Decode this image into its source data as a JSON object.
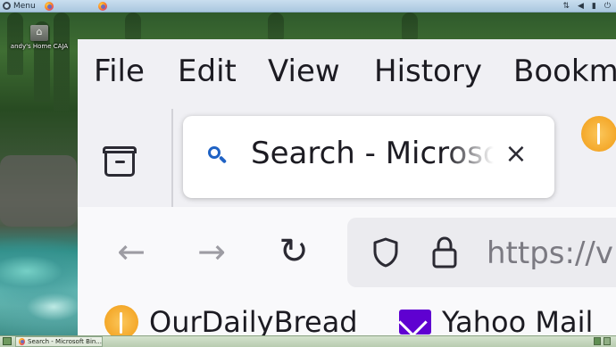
{
  "top_panel": {
    "menu_label": "Menu",
    "tray_icons": [
      "network-icon",
      "volume-icon",
      "battery-icon",
      "power-icon"
    ]
  },
  "desktop": {
    "home_icon_label": "andy's Home CAJA"
  },
  "browser": {
    "menu": [
      "File",
      "Edit",
      "View",
      "History",
      "Bookm"
    ],
    "active_tab": {
      "title": "Search - Microsoft",
      "close_glyph": "×"
    },
    "url": "https://v",
    "bookmarks": [
      "OurDailyBread",
      "Yahoo Mail"
    ]
  },
  "taskbar": {
    "window_title": "Search - Microsoft Bin..."
  },
  "colors": {
    "search_icon": "#1f62c4",
    "yahoo_purple": "#5f01d1",
    "odb_orange": "#f4a82a",
    "top_panel": "#aac7df",
    "taskbar": "#b8ccb0"
  }
}
